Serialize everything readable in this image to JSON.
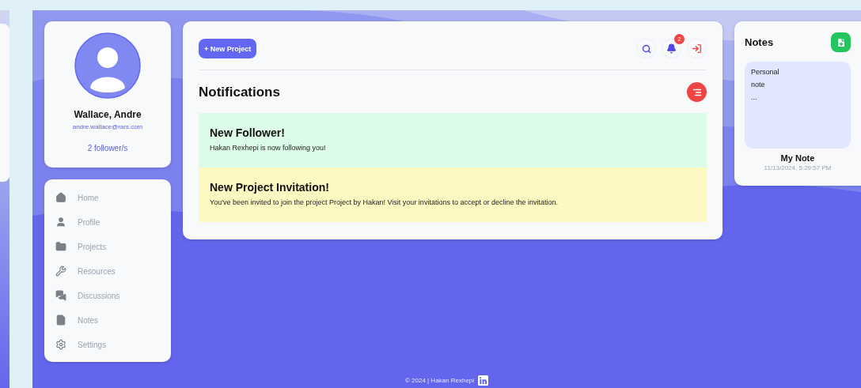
{
  "profile": {
    "name": "Wallace, Andre",
    "email": "andre.wallace@rars.com",
    "followers": "2 follower/s"
  },
  "nav": [
    {
      "label": "Home"
    },
    {
      "label": "Profile"
    },
    {
      "label": "Projects"
    },
    {
      "label": "Resources"
    },
    {
      "label": "Discussions"
    },
    {
      "label": "Notes"
    },
    {
      "label": "Settings"
    }
  ],
  "toolbar": {
    "new_project": "+ New Project",
    "notification_count": "2"
  },
  "notifications": {
    "title": "Notifications",
    "items": [
      {
        "title": "New Follower!",
        "message": "Hakan Rexhepi is now following you!",
        "color": "#dcfce7"
      },
      {
        "title": "New Project Invitation!",
        "message": "You've been invited to join the project Project by Hakan! Visit your invitations to accept or decline the invitation.",
        "color": "#fef9c3"
      }
    ]
  },
  "notes": {
    "title": "Notes",
    "items": [
      {
        "preview": [
          "Personal",
          "note",
          "..."
        ],
        "name": "My Note",
        "date": "11/13/2024, 5:29:57 PM"
      }
    ]
  },
  "footer": {
    "text": "© 2024 | Hakan Rexhepi"
  }
}
